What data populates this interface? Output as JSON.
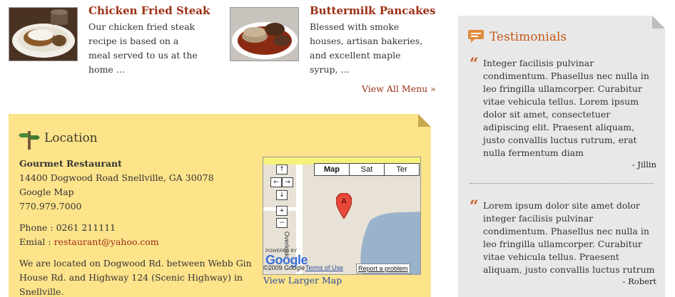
{
  "menu": {
    "items": [
      {
        "title": "Chicken Fried Steak",
        "description": "Our chicken fried steak recipe is based on a meal served to us at the home …"
      },
      {
        "title": "Buttermilk Pancakes",
        "description": "Blessed with smoke houses, artisan bakeries, and excellent maple syrup, …"
      }
    ],
    "view_all": "View All Menu »"
  },
  "location": {
    "title": "Location",
    "name": "Gourmet Restaurant",
    "address": "14400 Dogwood Road Snellville, GA 30078",
    "map_label": "Google Map",
    "phone_main": "770.979.7000",
    "phone_line": "Phone : 0261 211111",
    "email_label": "Emial : ",
    "email": "restaurant@yahoo.com",
    "directions": "We are located on Dogwood Rd. between Webb Gin House Rd. and Highway 124 (Scenic Highway) in Snellville.",
    "map": {
      "type_buttons": [
        "Map",
        "Sat",
        "Ter"
      ],
      "road_label": "Overlook",
      "powered_by": "POWERED BY",
      "logo": "Google",
      "copyright": "©2009 Google",
      "terms": "Terms of Use",
      "report": "Report a problem",
      "pin_letter": "A",
      "nav_up": "↑",
      "nav_left": "←",
      "nav_right": "→",
      "nav_down": "↓",
      "zoom_in": "+",
      "zoom_out": "−"
    },
    "larger_map": "View Larger Map"
  },
  "testimonials": {
    "title": "Testimonials",
    "quote_mark": "“",
    "items": [
      {
        "text": "Integer facilisis pulvinar condimentum. Phasellus nec nulla in leo fringilla ullamcorper. Curabitur vitae vehicula tellus. Lorem ipsum dolor sit amet, consectetuer adipiscing elit. Praesent aliquam, justo convallis luctus rutrum, erat nulla fermentum diam",
        "author": "- Jillin"
      },
      {
        "text": "Lorem ipsum dolor site amet dolor integer facilisis pulvinar condimentum. Phasellus nec nulla in leo fringilla ullamcorper. Curabitur vitae vehicula tellus. Praesent aliquam, justo convallis luctus rutrum",
        "author": "- Robert"
      }
    ]
  },
  "colors": {
    "accent": "#9b2f13",
    "location_bg": "#fde38a",
    "testimonials_bg": "#e8e8e8",
    "testimonial_title": "#c45a1a",
    "link_blue": "#2a4d9b"
  }
}
